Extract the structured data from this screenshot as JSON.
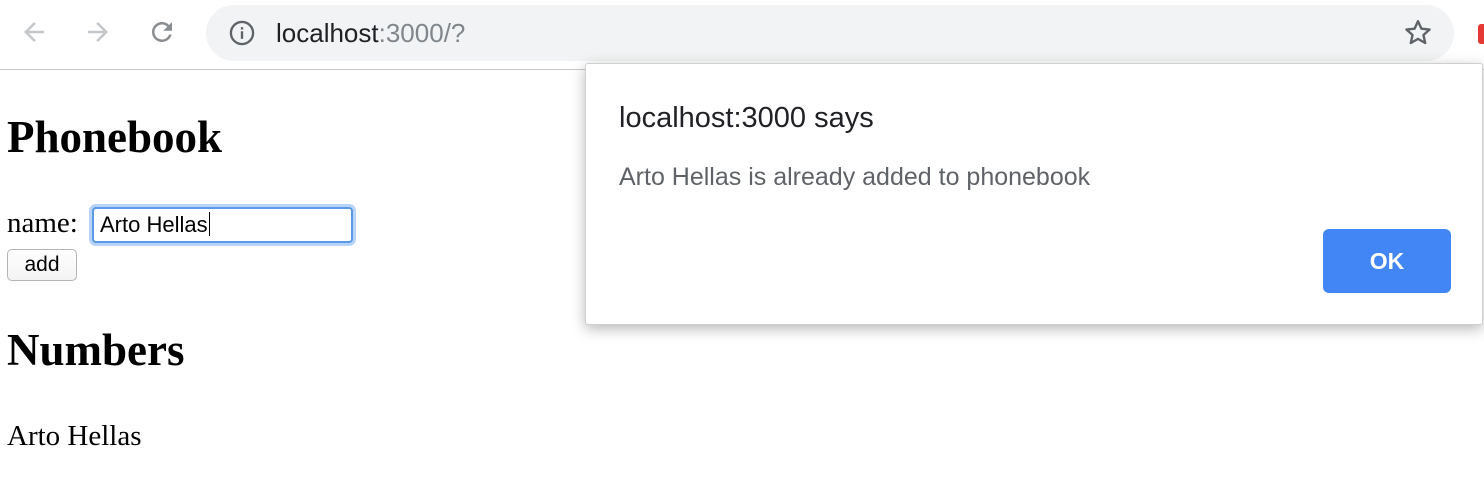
{
  "browser": {
    "url_host": "localhost",
    "url_rest": ":3000/?",
    "icons": {
      "back": "back-arrow-icon",
      "forward": "forward-arrow-icon",
      "reload": "reload-icon",
      "info": "info-icon",
      "bookmark": "star-icon"
    }
  },
  "page": {
    "title": "Phonebook",
    "form": {
      "name_label": "name:",
      "name_value": "Arto Hellas",
      "add_label": "add"
    },
    "numbers_title": "Numbers",
    "entries": [
      "Arto Hellas"
    ]
  },
  "dialog": {
    "title": "localhost:3000 says",
    "message": "Arto Hellas is already added to phonebook",
    "ok_label": "OK"
  },
  "colors": {
    "dialog_button": "#4285f4",
    "input_focus": "#5a9ae6",
    "omnibox_bg": "#f1f3f4"
  }
}
